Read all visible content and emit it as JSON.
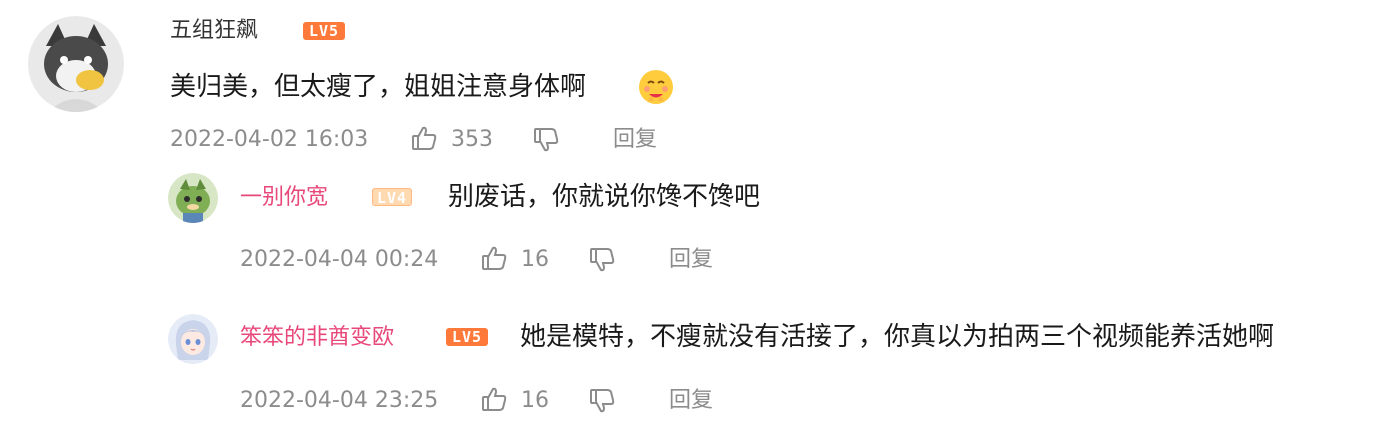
{
  "comments": [
    {
      "username": "五组狂飙",
      "level_badge": "LV5",
      "text": "美归美，但太瘦了，姐姐注意身体啊",
      "emoji": "hugging-face-emoji",
      "time": "2022-04-02 16:03",
      "likes": "353",
      "reply_label": "回复",
      "avatar": "gray-dog-avatar"
    }
  ],
  "replies": [
    {
      "username": "一别你宽",
      "level_badge": "LV4",
      "text": "别废话，你就说你馋不馋吧",
      "time": "2022-04-04 00:24",
      "likes": "16",
      "reply_label": "回复",
      "avatar": "green-creature-avatar"
    },
    {
      "username": "笨笨的非酋变欧",
      "level_badge": "LV5",
      "text": "她是模特，不瘦就没有活接了，你真以为拍两三个视频能养活她啊",
      "time": "2022-04-04 23:25",
      "likes": "16",
      "reply_label": "回复",
      "avatar": "anime-girl-avatar"
    }
  ],
  "colors": {
    "reply_username": "#e8477a",
    "badge_lv5": "#ff7a3a",
    "badge_lv4": "#ffd9b0",
    "meta_gray": "#8c8c8c"
  }
}
